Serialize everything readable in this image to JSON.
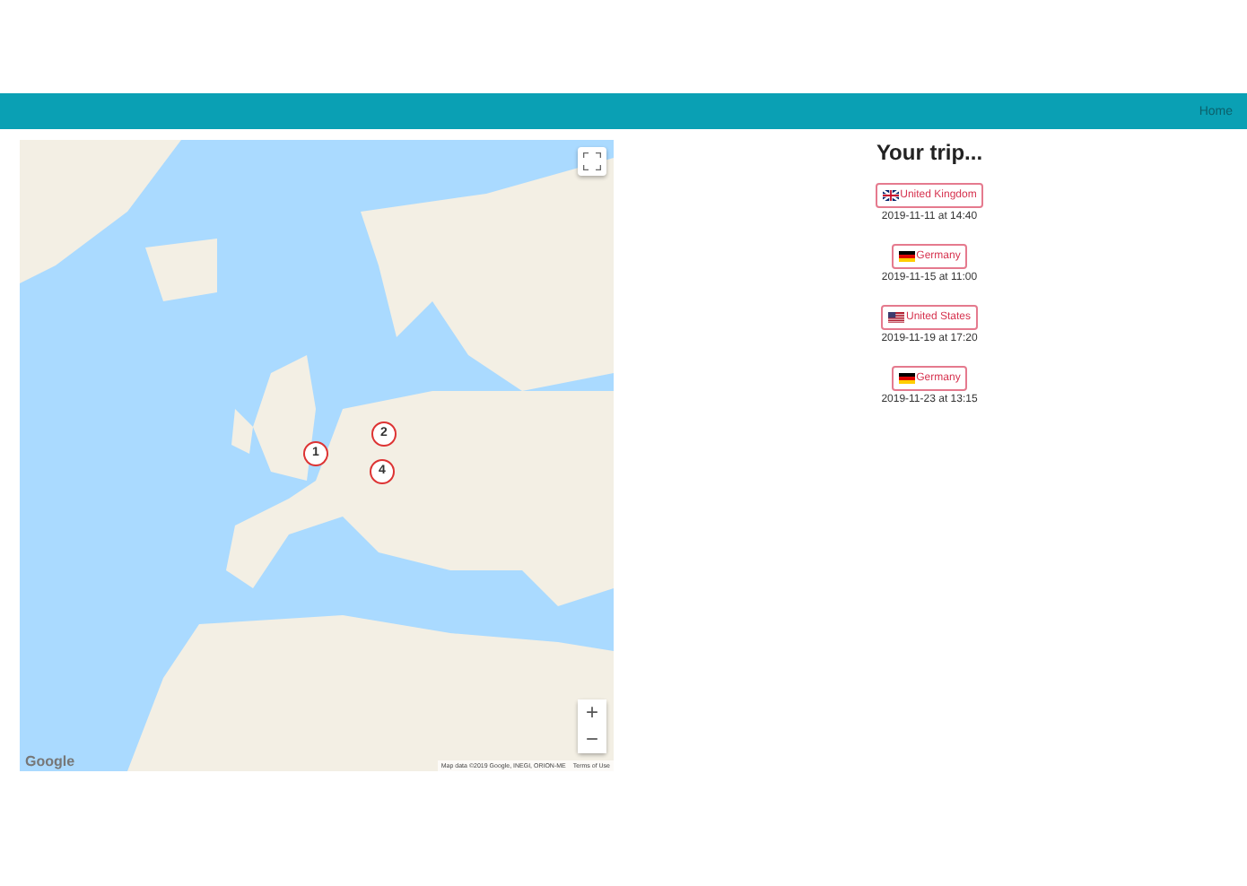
{
  "navbar": {
    "links": [
      {
        "label": "Home"
      }
    ]
  },
  "map": {
    "markers": [
      {
        "label": "1"
      },
      {
        "label": "2"
      },
      {
        "label": "4"
      }
    ],
    "attribution": "Map data ©2019 Google, INEGI, ORION-ME",
    "terms": "Terms of Use",
    "logo": "Google",
    "zoom_in": "+",
    "zoom_out": "−"
  },
  "trip": {
    "title": "Your trip...",
    "stops": [
      {
        "country": "United Kingdom",
        "kind": "uk",
        "date": "2019-11-11 at 14:40"
      },
      {
        "country": "Germany",
        "kind": "de",
        "date": "2019-11-15 at 11:00"
      },
      {
        "country": "United States",
        "kind": "us",
        "date": "2019-11-19 at 17:20"
      },
      {
        "country": "Germany",
        "kind": "de",
        "date": "2019-11-23 at 13:15"
      }
    ]
  }
}
